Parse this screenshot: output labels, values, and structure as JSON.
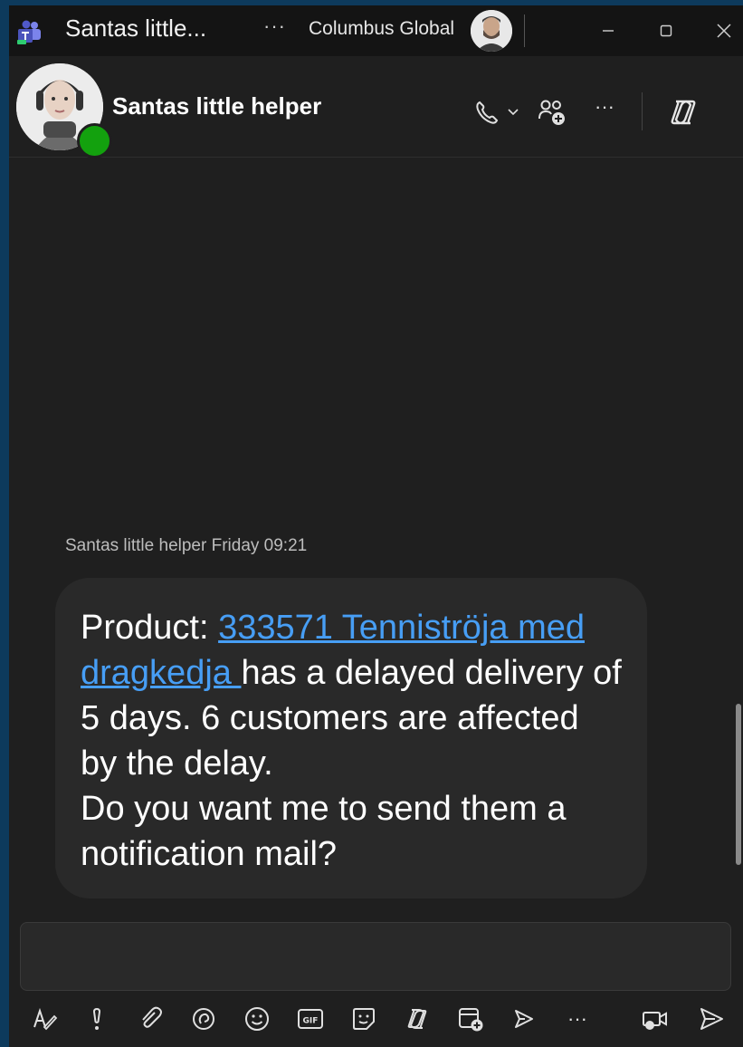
{
  "titlebar": {
    "app_title": "Santas little...",
    "more": "···",
    "org_name": "Columbus Global",
    "icons": [
      "teams-icon",
      "more-icon",
      "user-avatar",
      "minimize-icon",
      "maximize-icon",
      "close-icon"
    ]
  },
  "chat": {
    "name": "Santas little helper",
    "presence": "available",
    "header_more": "···"
  },
  "message": {
    "sender": "Santas little helper",
    "time": "Friday 09:21",
    "prefix": "Product: ",
    "link_text": "333571 Tenniströja med dragkedja ",
    "body": "has a delayed delivery of 5 days. 6 customers are affected by the delay.",
    "question": "Do you want me to send them a notification mail?"
  },
  "compose": {
    "value": "",
    "more": "···",
    "gif_label": "GIF"
  },
  "colors": {
    "background": "#1f1f1f",
    "bubble": "#292929",
    "link": "#479ef5",
    "presence": "#13a10e"
  }
}
